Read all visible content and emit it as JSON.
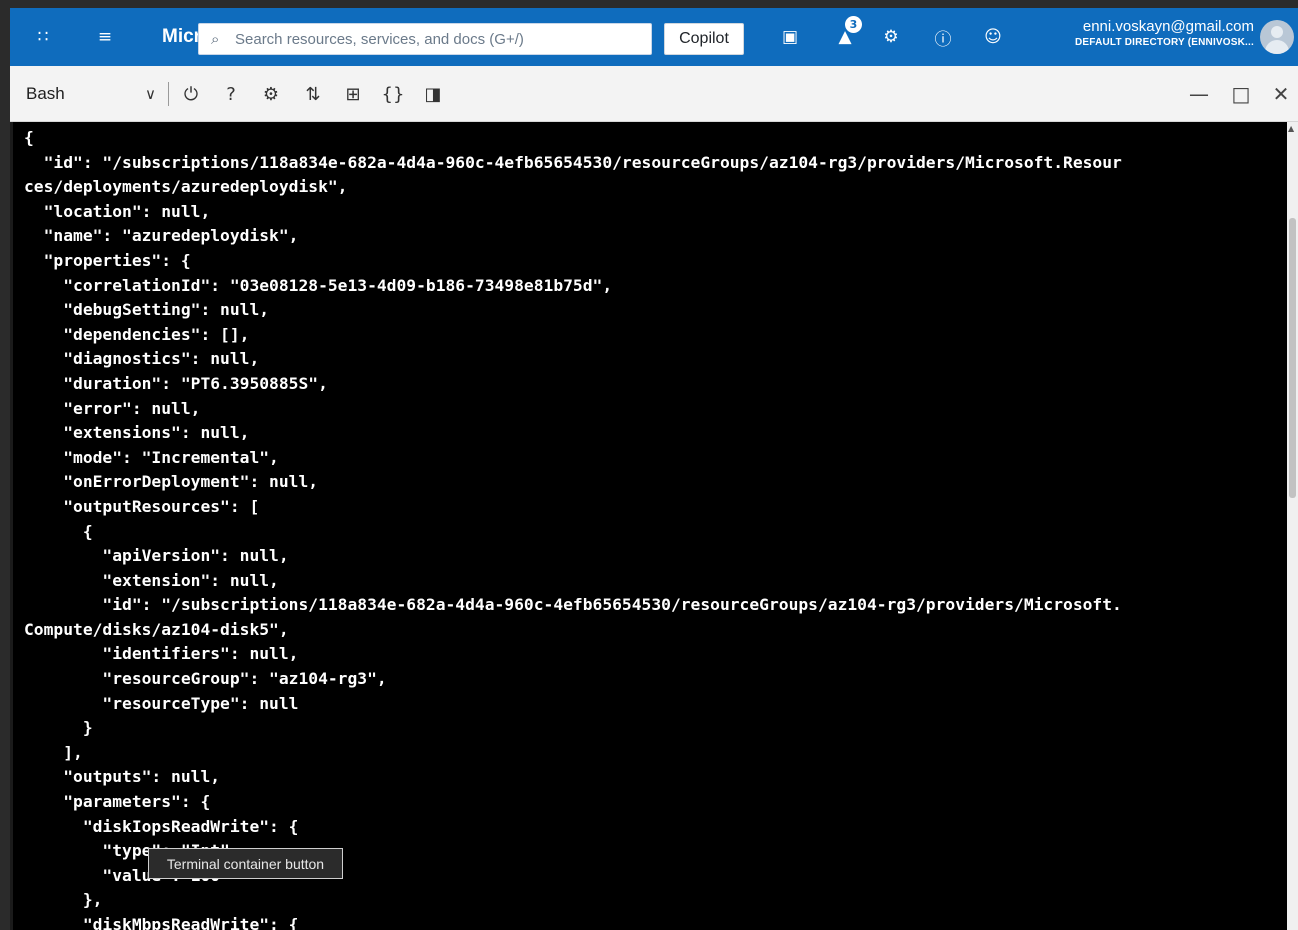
{
  "topbar": {
    "brand": "Micr",
    "search_placeholder": "Search resources, services, and docs (G+/)",
    "copilot_label": "Copilot",
    "notification_count": "3",
    "user_email": "enni.voskayn@gmail.com",
    "user_directory": "DEFAULT DIRECTORY (ENNIVOSK...",
    "icons": [
      "grid-icon",
      "menu-icon",
      "search-icon",
      "cloud-shell-icon",
      "bell-icon",
      "settings-icon",
      "help-icon",
      "feedback-icon"
    ],
    "accent_color": "#0f6cbd"
  },
  "shell": {
    "selected_shell": "Bash",
    "toolbar_icons": [
      "power-icon",
      "help-icon",
      "settings-icon",
      "upload-download-icon",
      "new-session-icon",
      "editor-icon",
      "web-preview-icon"
    ],
    "window_icons": [
      "minimize-icon",
      "maximize-icon",
      "close-icon"
    ]
  },
  "terminal": {
    "lines": [
      "{",
      "  \"id\": \"/subscriptions/118a834e-682a-4d4a-960c-4efb65654530/resourceGroups/az104-rg3/providers/Microsoft.Resour",
      "ces/deployments/azuredeploydisk\",",
      "  \"location\": null,",
      "  \"name\": \"azuredeploydisk\",",
      "  \"properties\": {",
      "    \"correlationId\": \"03e08128-5e13-4d09-b186-73498e81b75d\",",
      "    \"debugSetting\": null,",
      "    \"dependencies\": [],",
      "    \"diagnostics\": null,",
      "    \"duration\": \"PT6.3950885S\",",
      "    \"error\": null,",
      "    \"extensions\": null,",
      "    \"mode\": \"Incremental\",",
      "    \"onErrorDeployment\": null,",
      "    \"outputResources\": [",
      "      {",
      "        \"apiVersion\": null,",
      "        \"extension\": null,",
      "        \"id\": \"/subscriptions/118a834e-682a-4d4a-960c-4efb65654530/resourceGroups/az104-rg3/providers/Microsoft.",
      "Compute/disks/az104-disk5\",",
      "        \"identifiers\": null,",
      "        \"resourceGroup\": \"az104-rg3\",",
      "        \"resourceType\": null",
      "      }",
      "    ],",
      "    \"outputs\": null,",
      "    \"parameters\": {",
      "      \"diskIopsReadWrite\": {",
      "        \"type\": \"Int\",",
      "        \"value\": 100",
      "      },",
      "      \"diskMbpsReadWrite\": {"
    ]
  },
  "tooltip": {
    "text": "Terminal container button"
  }
}
